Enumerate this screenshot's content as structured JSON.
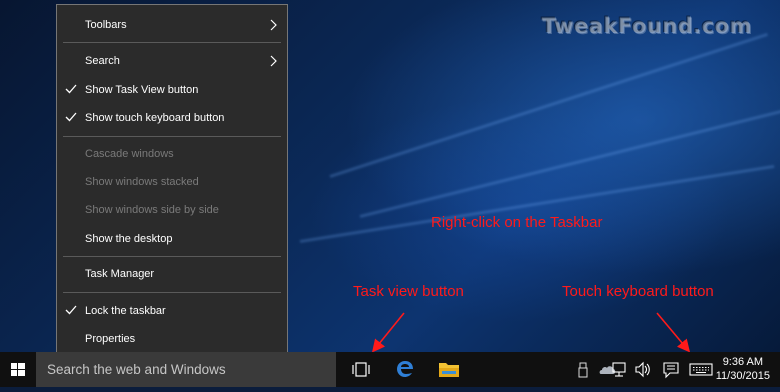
{
  "watermark": "TweakFound.com",
  "context_menu": {
    "items": [
      {
        "label": "Toolbars",
        "checked": false,
        "enabled": true,
        "submenu": true
      },
      {
        "label": "Search",
        "checked": false,
        "enabled": true,
        "submenu": true
      },
      {
        "label": "Show Task View button",
        "checked": true,
        "enabled": true,
        "submenu": false
      },
      {
        "label": "Show touch keyboard button",
        "checked": true,
        "enabled": true,
        "submenu": false
      },
      {
        "label": "Cascade windows",
        "checked": false,
        "enabled": false,
        "submenu": false
      },
      {
        "label": "Show windows stacked",
        "checked": false,
        "enabled": false,
        "submenu": false
      },
      {
        "label": "Show windows side by side",
        "checked": false,
        "enabled": false,
        "submenu": false
      },
      {
        "label": "Show the desktop",
        "checked": false,
        "enabled": true,
        "submenu": false
      },
      {
        "label": "Task Manager",
        "checked": false,
        "enabled": true,
        "submenu": false
      },
      {
        "label": "Lock the taskbar",
        "checked": true,
        "enabled": true,
        "submenu": false
      },
      {
        "label": "Properties",
        "checked": false,
        "enabled": true,
        "submenu": false
      }
    ]
  },
  "annotations": {
    "main": "Right-click on the Taskbar",
    "task_view": "Task view button",
    "touch_keyboard": "Touch keyboard button",
    "color": "#ff1a1a"
  },
  "taskbar": {
    "search_placeholder": "Search the web and Windows",
    "icons": [
      "windows-logo-icon",
      "task-view-icon",
      "edge-icon",
      "file-explorer-icon",
      "usb-icon",
      "onedrive-icon",
      "network-icon",
      "volume-icon",
      "action-center-icon",
      "touch-keyboard-icon"
    ],
    "time": "9:36 AM",
    "date": "11/30/2015"
  },
  "colors": {
    "menu_bg": "#2b2b2b",
    "taskbar_bg": "#101010",
    "search_bg": "#3a3a3a",
    "edge_blue": "#2f7fd6",
    "folder_yellow": "#f2c233"
  }
}
